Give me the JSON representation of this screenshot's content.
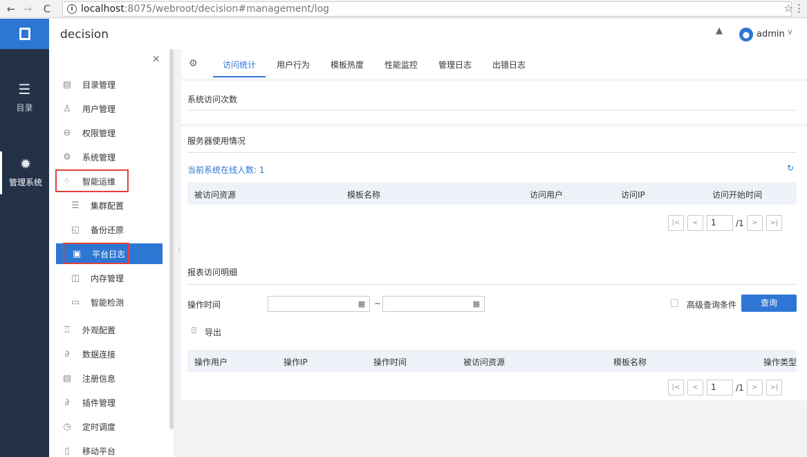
{
  "browser": {
    "url_host": "localhost",
    "url_path": ":8075/webroot/decision#management/log"
  },
  "header": {
    "title": "decision",
    "user": "admin"
  },
  "rail": {
    "items": [
      {
        "label": "目录",
        "icon": "list-icon"
      },
      {
        "label": "管理系统",
        "icon": "gear-icon"
      }
    ]
  },
  "sidebar": {
    "items": [
      {
        "label": "目录管理",
        "icon": "directory-icon"
      },
      {
        "label": "用户管理",
        "icon": "user-icon"
      },
      {
        "label": "权限管理",
        "icon": "lock-icon"
      },
      {
        "label": "系统管理",
        "icon": "settings-icon"
      },
      {
        "label": "智能运维",
        "icon": "ops-icon"
      },
      {
        "label": "集群配置",
        "icon": "cluster-icon"
      },
      {
        "label": "备份还原",
        "icon": "backup-icon"
      },
      {
        "label": "平台日志",
        "icon": "log-icon"
      },
      {
        "label": "内存管理",
        "icon": "memory-icon"
      },
      {
        "label": "智能检测",
        "icon": "monitor-icon"
      },
      {
        "label": "外观配置",
        "icon": "paint-icon"
      },
      {
        "label": "数据连接",
        "icon": "link-icon"
      },
      {
        "label": "注册信息",
        "icon": "register-icon"
      },
      {
        "label": "插件管理",
        "icon": "plugin-icon"
      },
      {
        "label": "定时调度",
        "icon": "timer-icon"
      },
      {
        "label": "移动平台",
        "icon": "mobile-icon"
      }
    ]
  },
  "tabs": [
    {
      "label": "访问统计"
    },
    {
      "label": "用户行为"
    },
    {
      "label": "模板热度"
    },
    {
      "label": "性能监控"
    },
    {
      "label": "管理日志"
    },
    {
      "label": "出错日志"
    }
  ],
  "visits": {
    "title": "系统访问次数"
  },
  "server": {
    "title": "服务器使用情况",
    "online": "当前系统在线人数: 1",
    "columns": [
      "被访问资源",
      "模板名称",
      "访问用户",
      "访问IP",
      "访问开始时间"
    ],
    "pager": {
      "page": "1",
      "total": "/1"
    }
  },
  "detail": {
    "title": "报表访问明细",
    "time_label": "操作时间",
    "tilde": "~",
    "advanced": "高级查询条件",
    "query": "查询",
    "export": "导出",
    "columns": [
      "操作用户",
      "操作IP",
      "操作时间",
      "被访问资源",
      "模板名称",
      "操作类型"
    ],
    "pager": {
      "page": "1",
      "total": "/1"
    }
  },
  "colors": {
    "accent": "#2e76d4",
    "rail": "#243248",
    "highlight": "#e0413d"
  }
}
